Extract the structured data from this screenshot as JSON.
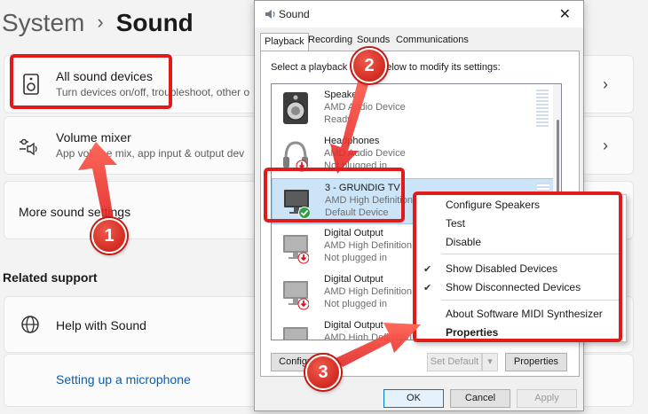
{
  "settings": {
    "breadcrumb_parent": "System",
    "breadcrumb_sep": "›",
    "page_title": "Sound",
    "cards": [
      {
        "title": "All sound devices",
        "subtitle": "Turn devices on/off, troubleshoot, other o",
        "icon": "speaker-device-icon"
      },
      {
        "title": "Volume mixer",
        "subtitle": "App volume mix, app input & output dev",
        "icon": "mixer-icon"
      },
      {
        "title": "More sound settings"
      },
      {
        "title": "Help with Sound",
        "icon": "globe-icon"
      },
      {
        "title": "Setting up a microphone"
      }
    ],
    "related_support": "Related support",
    "chevron": "›"
  },
  "dialog": {
    "title": "Sound",
    "close_glyph": "✕",
    "tabs": [
      "Playback",
      "Recording",
      "Sounds",
      "Communications"
    ],
    "instruction": "Select a playback device below to modify its settings:",
    "devices": [
      {
        "name": "Speakers",
        "desc": "AMD Audio Device",
        "status": "Ready",
        "icon": "speaker-icon"
      },
      {
        "name": "Headphones",
        "desc": "AMD Audio Device",
        "status": "Not plugged in",
        "icon": "headphones-icon"
      },
      {
        "name": "3 - GRUNDIG TV",
        "desc": "AMD High Definition Au",
        "status": "Default Device",
        "icon": "monitor-icon"
      },
      {
        "name": "Digital Output",
        "desc": "AMD High Definition Au",
        "status": "Not plugged in",
        "icon": "monitor-icon"
      },
      {
        "name": "Digital Output",
        "desc": "AMD High Definition Au",
        "status": "Not plugged in",
        "icon": "monitor-icon"
      },
      {
        "name": "Digital Output",
        "desc": "AMD High Definition Au",
        "status": "",
        "icon": "monitor-icon"
      }
    ],
    "buttons": {
      "configure": "Configure",
      "set_default": "Set Default",
      "set_default_arrow": "▾",
      "properties": "Properties",
      "ok": "OK",
      "cancel": "Cancel",
      "apply": "Apply"
    }
  },
  "context_menu": {
    "items": [
      {
        "label": "Configure Speakers",
        "checked": false,
        "bold": false
      },
      {
        "label": "Test",
        "checked": false,
        "bold": false
      },
      {
        "label": "Disable",
        "checked": false,
        "bold": false
      },
      {
        "label": "Show Disabled Devices",
        "checked": true,
        "bold": false
      },
      {
        "label": "Show Disconnected Devices",
        "checked": true,
        "bold": false
      },
      {
        "label": "About Software MIDI Synthesizer",
        "checked": false,
        "bold": false
      },
      {
        "label": "Properties",
        "checked": false,
        "bold": true
      }
    ],
    "check_glyph": "✔"
  },
  "annotations": {
    "badges": [
      "1",
      "2",
      "3"
    ],
    "color": "#e01b1b"
  },
  "colors": {
    "selection": "#cce4f7",
    "link": "#0b5cad",
    "default_check": "#2ea043"
  }
}
